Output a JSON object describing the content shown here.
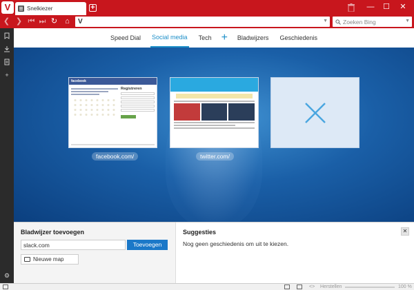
{
  "titlebar": {
    "logo": "V",
    "tab_label": "Snelkiezer",
    "new_tab": "+",
    "minimize": "—",
    "maximize": "☐",
    "close": "✕"
  },
  "addressbar": {
    "url_value": "",
    "search_placeholder": "Zoeken Bing"
  },
  "speed_dial_nav": {
    "items": [
      {
        "label": "Speed Dial",
        "active": false
      },
      {
        "label": "Social media",
        "active": true
      },
      {
        "label": "Tech",
        "active": false
      }
    ],
    "add": "+",
    "bookmarks": "Bladwijzers",
    "history": "Geschiedenis"
  },
  "dials": [
    {
      "label": "facebook.com/",
      "thumb_brand": "facebook",
      "thumb_heading": "Registreren"
    },
    {
      "label": "twitter.com/"
    },
    {
      "label": ""
    }
  ],
  "bookmark_panel": {
    "title": "Bladwijzer toevoegen",
    "input_value": "slack.com",
    "add_button": "Toevoegen",
    "new_folder": "Nieuwe map"
  },
  "suggestions": {
    "title": "Suggesties",
    "empty_text": "Nog geen geschiedenis om uit te kiezen.",
    "close": "✕"
  },
  "statusbar": {
    "reset": "Herstellen",
    "zoom": "100 %"
  },
  "colors": {
    "brand": "#c8161d",
    "accent": "#1b8ec8",
    "sidebar": "#2b2b2b"
  }
}
